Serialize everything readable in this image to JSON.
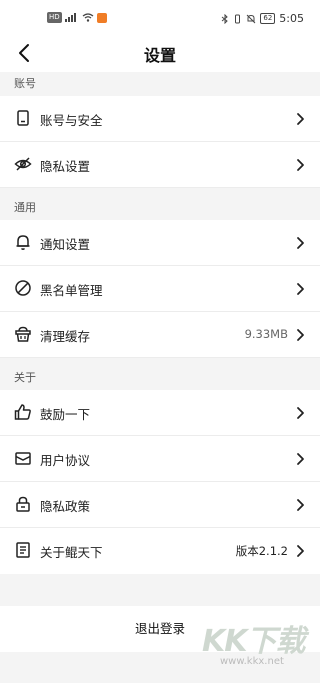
{
  "status_bar": {
    "left_icons": [
      "hd-icon",
      "signal-icon",
      "wifi-icon",
      "app-icon"
    ],
    "hd": "HD",
    "battery": "62",
    "time": "5:05"
  },
  "header": {
    "title": "设置",
    "back_icon": "chevron-left-icon"
  },
  "sections": [
    {
      "title": "账号",
      "items": [
        {
          "label": "账号与安全",
          "icon": "phone-icon",
          "value": ""
        },
        {
          "label": "隐私设置",
          "icon": "eye-slash-icon",
          "value": ""
        }
      ]
    },
    {
      "title": "通用",
      "items": [
        {
          "label": "通知设置",
          "icon": "bell-icon",
          "value": ""
        },
        {
          "label": "黑名单管理",
          "icon": "block-icon",
          "value": ""
        },
        {
          "label": "清理缓存",
          "icon": "basket-icon",
          "value": "9.33MB"
        }
      ]
    },
    {
      "title": "关于",
      "items": [
        {
          "label": "鼓励一下",
          "icon": "thumbs-up-icon",
          "value": ""
        },
        {
          "label": "用户协议",
          "icon": "envelope-icon",
          "value": ""
        },
        {
          "label": "隐私政策",
          "icon": "lock-icon",
          "value": ""
        },
        {
          "label": "关于鲲天下",
          "icon": "document-icon",
          "value": "版本2.1.2"
        }
      ]
    }
  ],
  "logout": {
    "label": "退出登录"
  },
  "watermark": {
    "brand": "KK下载",
    "url": "www.kkx.net"
  }
}
